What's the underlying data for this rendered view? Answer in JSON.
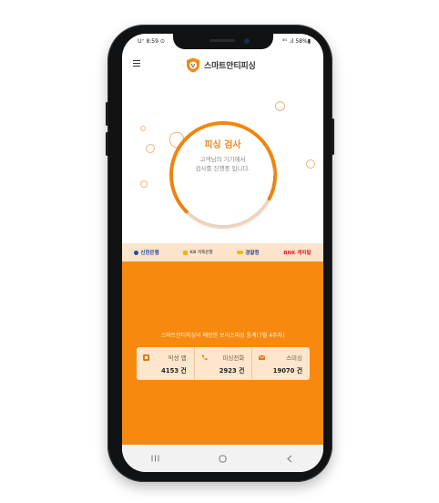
{
  "status": {
    "left": "U⁺ 8:59 ⊙",
    "right": "⁴ᴳ .ıl 58%▮"
  },
  "app": {
    "title": "스마트안티피싱"
  },
  "scan": {
    "title": "피싱 검사",
    "message_line1": "고객님의 기기에서",
    "message_line2": "검사를 진행중 입니다."
  },
  "partners": [
    {
      "label": "신한은행",
      "color": "#1d4fa3",
      "icon": "shinhan-logo"
    },
    {
      "label": "KB 저축은행",
      "color": "#6c6a5a",
      "icon": "kb-logo"
    },
    {
      "label": "경찰청",
      "color": "#2a4a8a",
      "icon": "police-logo"
    },
    {
      "label": "BNK 캐피탈",
      "color": "#e0262b",
      "icon": "bnk-logo"
    }
  ],
  "stats": {
    "caption": "스마트안티피싱이 예방한 보이스피싱 통계(7월 4주차)",
    "items": [
      {
        "label": "악성 앱",
        "value": "4153 건",
        "icon": "app-icon"
      },
      {
        "label": "피싱전화",
        "value": "2923 건",
        "icon": "phone-icon"
      },
      {
        "label": "스미싱",
        "value": "19070 건",
        "icon": "mail-icon"
      }
    ]
  },
  "progress": 0.7,
  "colors": {
    "accent": "#f7890f",
    "accent_light": "#fde6cc"
  },
  "nav": [
    "recent-apps-icon",
    "home-icon",
    "back-icon"
  ]
}
